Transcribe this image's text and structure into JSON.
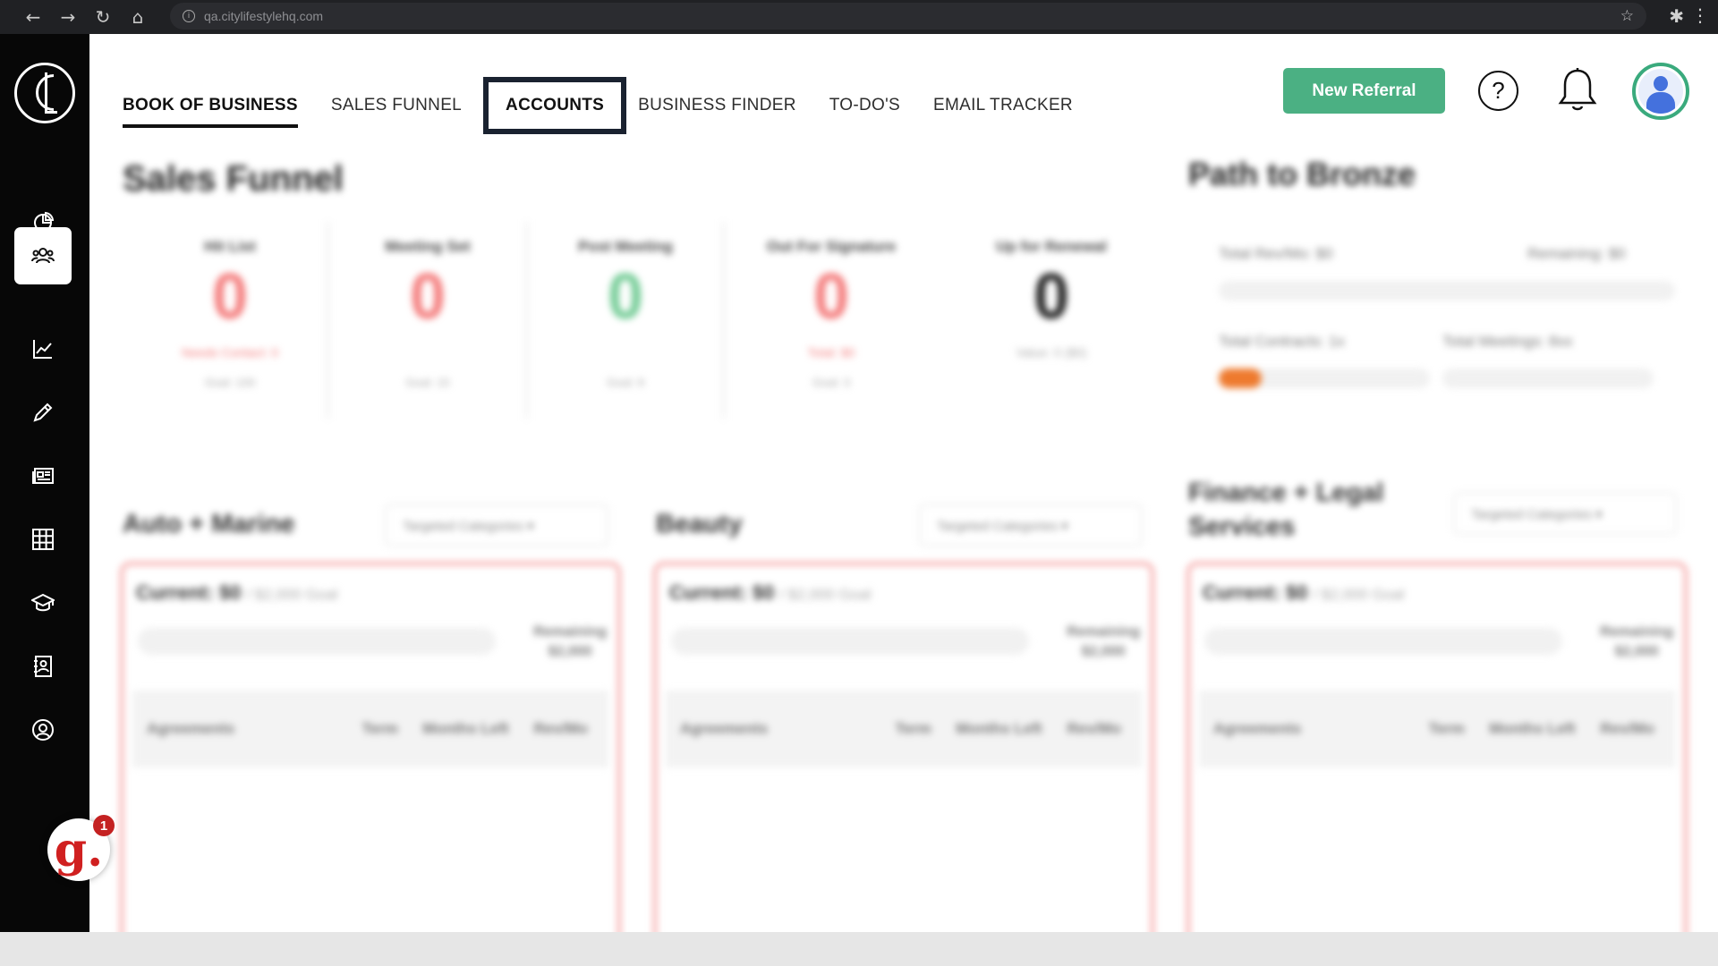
{
  "browser": {
    "url": "qa.citylifestylehq.com",
    "nav_icons": [
      "back-icon",
      "forward-icon",
      "reload-icon",
      "home-icon"
    ]
  },
  "sidebar": {
    "items": [
      {
        "name": "dashboard",
        "icon": "pie-chart-icon"
      },
      {
        "name": "book-of-business",
        "icon": "users-icon",
        "active": true
      },
      {
        "name": "analytics",
        "icon": "line-chart-icon"
      },
      {
        "name": "tools",
        "icon": "pencil-icon"
      },
      {
        "name": "news",
        "icon": "newspaper-icon"
      },
      {
        "name": "grid",
        "icon": "grid-icon"
      },
      {
        "name": "training",
        "icon": "graduation-cap-icon"
      },
      {
        "name": "contacts",
        "icon": "contact-book-icon"
      },
      {
        "name": "account",
        "icon": "user-circle-icon"
      }
    ]
  },
  "topnav": {
    "tabs": [
      {
        "label": "BOOK OF BUSINESS"
      },
      {
        "label": "SALES FUNNEL"
      },
      {
        "label": "ACCOUNTS"
      },
      {
        "label": "BUSINESS FINDER"
      },
      {
        "label": "TO-DO'S"
      },
      {
        "label": "EMAIL TRACKER"
      }
    ],
    "current_index": 0,
    "highlight_index": 2
  },
  "header": {
    "new_referral_label": "New Referral",
    "help_symbol": "?"
  },
  "sales_funnel": {
    "title": "Sales Funnel",
    "columns": [
      {
        "label": "Hit List",
        "value": "0",
        "sub1": "Needs Contact: 0",
        "sub2": "Goal: 100",
        "color": "#f47d7d"
      },
      {
        "label": "Meeting Set",
        "value": "0",
        "sub1": "",
        "sub2": "Goal: 15",
        "color": "#f47d7d"
      },
      {
        "label": "Post Meeting",
        "value": "0",
        "sub1": "",
        "sub2": "Goal: 8",
        "color": "#74cc96"
      },
      {
        "label": "Out For Signature",
        "value": "0",
        "sub1": "Total: $0",
        "sub2": "Goal: 3",
        "color": "#f47d7d"
      },
      {
        "label": "Up for Renewal",
        "value": "0",
        "sub1": "Value: 0 ($0)",
        "sub2": "",
        "color": "#222222"
      }
    ]
  },
  "path_to_bronze": {
    "title": "Path to Bronze",
    "total_rev": "Total Rev/Mo: $0",
    "remaining": "Remaining: $0",
    "total_contracts": "Total Contracts: 1x",
    "total_meetings": "Total Meetings: 8xx"
  },
  "categories": [
    {
      "title": "Auto + Marine",
      "dropdown": "Targeted Categories",
      "current": "Current: $0",
      "goal": "/ $2,000 Goal",
      "remaining": "Remaining",
      "remaining_value": "$2,000"
    },
    {
      "title": "Beauty",
      "dropdown": "Targeted Categories",
      "current": "Current: $0",
      "goal": "/ $2,000 Goal",
      "remaining": "Remaining",
      "remaining_value": "$2,000"
    },
    {
      "title": "Finance + Legal Services",
      "dropdown": "Targeted Categories",
      "current": "Current: $0",
      "goal": "/ $2,000 Goal",
      "remaining": "Remaining",
      "remaining_value": "$2,000"
    }
  ],
  "table_headers": [
    "Agreements",
    "Term",
    "Months Left",
    "Rev/Mo"
  ],
  "chat_widget": {
    "letter": "g.",
    "count": "1"
  }
}
